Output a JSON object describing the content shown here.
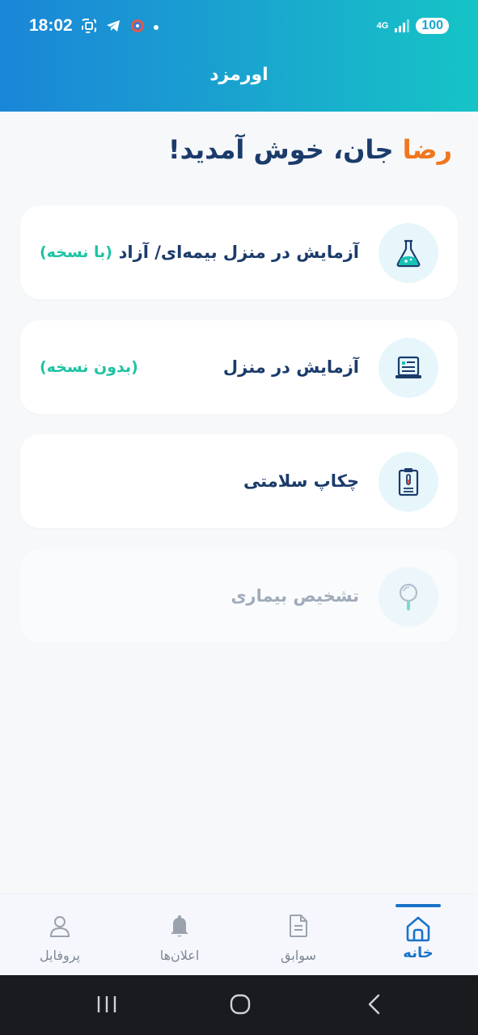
{
  "status_bar": {
    "time": "18:02",
    "network": "4G",
    "battery": "100"
  },
  "header": {
    "title": "اورمزد"
  },
  "welcome": {
    "name": "رضا",
    "message": " جان، خوش آمدید!"
  },
  "services": [
    {
      "title": "آزمایش در منزل بیمه‌ای/ آزاد",
      "note": "(با نسخه)",
      "icon": "flask-icon",
      "enabled": true
    },
    {
      "title": "آزمایش در منزل",
      "note": "(بدون نسخه)",
      "icon": "report-screen-icon",
      "enabled": true
    },
    {
      "title": "چکاپ سلامتی",
      "note": "",
      "icon": "checkup-clipboard-icon",
      "enabled": true
    },
    {
      "title": "تشخیص بیماری",
      "note": "",
      "icon": "magnifier-icon",
      "enabled": false
    }
  ],
  "bottom_nav": {
    "items": [
      {
        "label": "خانه",
        "icon": "home-icon",
        "active": true
      },
      {
        "label": "سوابق",
        "icon": "document-icon",
        "active": false
      },
      {
        "label": "اعلان‌ها",
        "icon": "bell-icon",
        "active": false
      },
      {
        "label": "پروفایل",
        "icon": "user-icon",
        "active": false
      }
    ]
  },
  "colors": {
    "accent": "#1a73c8",
    "brand_name": "#f0761e",
    "note_green": "#1fc3a3",
    "title_navy": "#1b3b6b"
  }
}
